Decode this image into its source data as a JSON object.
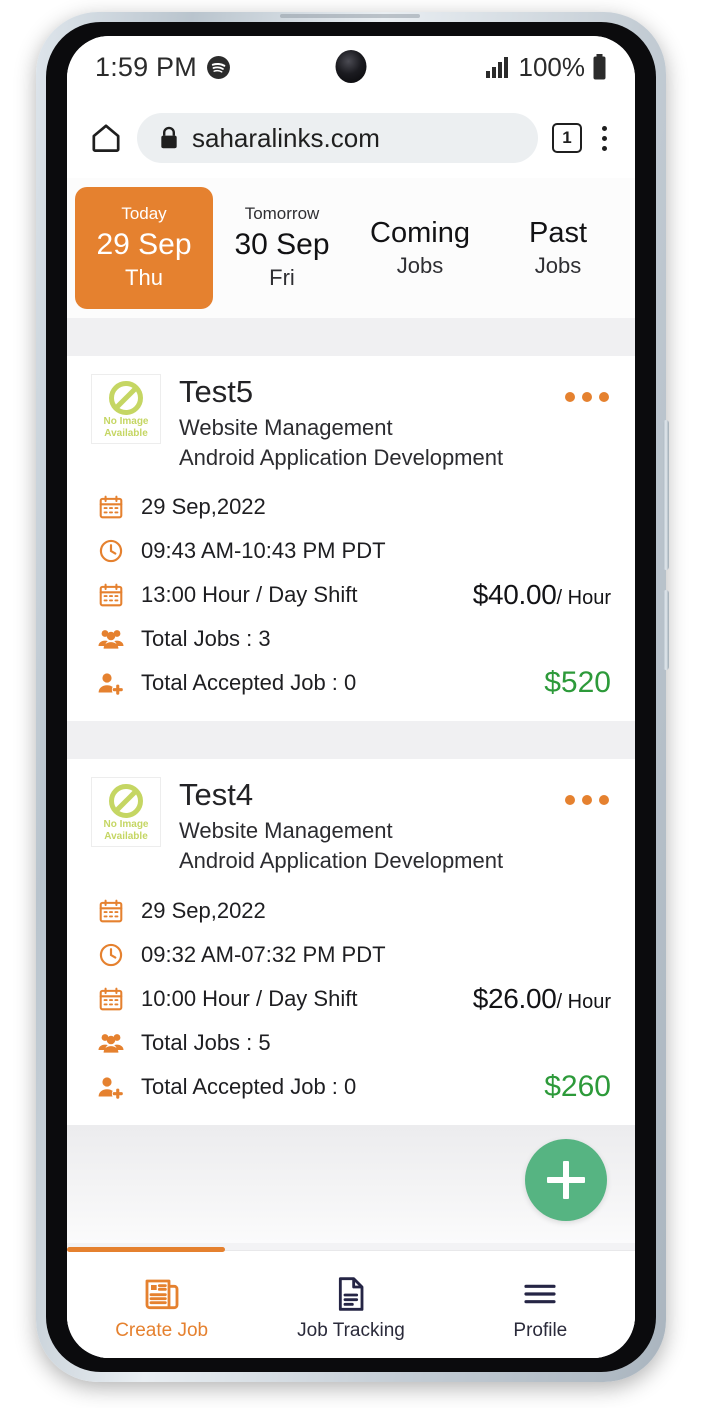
{
  "status_bar": {
    "time": "1:59 PM",
    "spotify_icon": "spotify-icon",
    "signal_icon": "signal-bars-icon",
    "battery_percent": "100%",
    "battery_icon": "battery-full-icon"
  },
  "browser": {
    "home_icon": "home-icon",
    "lock_icon": "lock-icon",
    "url": "saharalinks.com",
    "tab_count": "1",
    "menu_icon": "overflow-menu-icon"
  },
  "date_tabs": [
    {
      "top": "Today",
      "mid": "29 Sep",
      "bottom": "Thu",
      "active": true
    },
    {
      "top": "Tomorrow",
      "mid": "30 Sep",
      "bottom": "Fri",
      "active": false
    },
    {
      "top": "",
      "mid": "Coming",
      "bottom": "Jobs",
      "active": false
    },
    {
      "top": "",
      "mid": "Past",
      "bottom": "Jobs",
      "active": false
    }
  ],
  "jobs": [
    {
      "thumb_line1": "No  Image",
      "thumb_line2": "Available",
      "title": "Test5",
      "subtitle1": "Website Management",
      "subtitle2": "Android Application Development",
      "menu_icon": "kebab-menu-icon",
      "date": "29 Sep,2022",
      "time_range": "09:43 AM-10:43 PM PDT",
      "shift": "13:00 Hour / Day Shift",
      "rate_amount": "$40.00",
      "rate_unit": "/ Hour",
      "total_jobs": "Total Jobs : 3",
      "accepted_jobs": "Total Accepted Job : 0",
      "total_amount": "$520"
    },
    {
      "thumb_line1": "No  Image",
      "thumb_line2": "Available",
      "title": "Test4",
      "subtitle1": "Website Management",
      "subtitle2": "Android Application Development",
      "menu_icon": "kebab-menu-icon",
      "date": "29 Sep,2022",
      "time_range": "09:32 AM-07:32 PM PDT",
      "shift": "10:00 Hour / Day Shift",
      "rate_amount": "$26.00",
      "rate_unit": "/ Hour",
      "total_jobs": "Total Jobs : 5",
      "accepted_jobs": "Total Accepted Job : 0",
      "total_amount": "$260"
    }
  ],
  "fab": {
    "icon": "plus-icon",
    "color": "#56b482"
  },
  "bottom_nav": [
    {
      "label": "Create Job",
      "icon": "newspaper-icon",
      "active": true
    },
    {
      "label": "Job Tracking",
      "icon": "document-icon",
      "active": false
    },
    {
      "label": "Profile",
      "icon": "hamburger-icon",
      "active": false
    }
  ],
  "colors": {
    "accent_orange": "#e5812f",
    "money_green": "#2d9a3a",
    "fab_green": "#56b482",
    "placeholder_green": "#c5d663"
  }
}
